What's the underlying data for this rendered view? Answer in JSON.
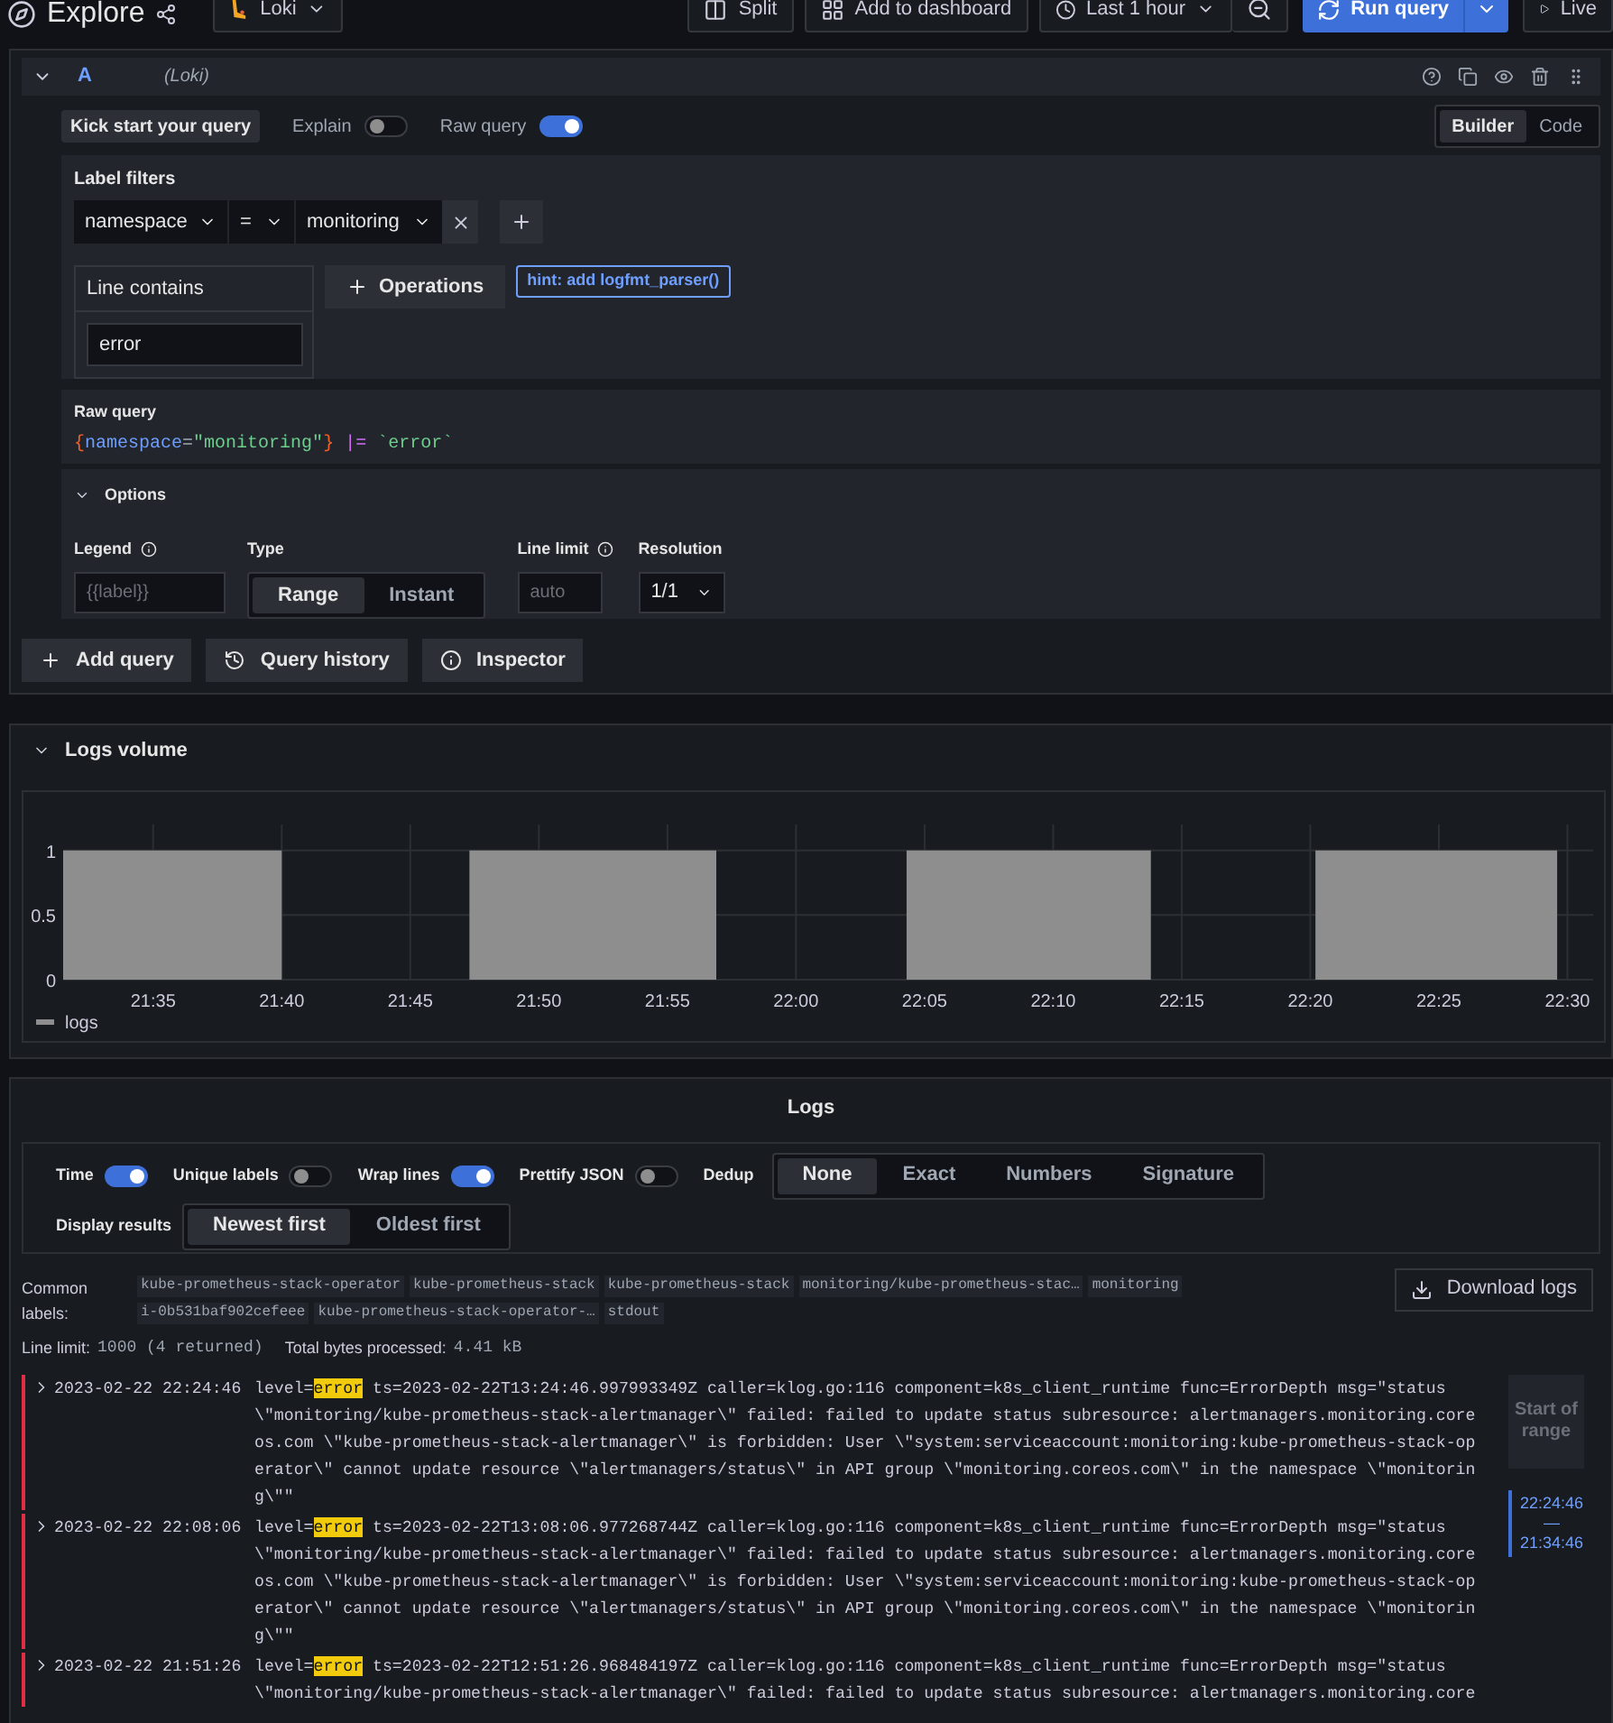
{
  "toolbar": {
    "title": "Explore",
    "datasource": "Loki",
    "split": "Split",
    "add_to_dashboard": "Add to dashboard",
    "time_range": "Last 1 hour",
    "run_query": "Run query",
    "live": "Live"
  },
  "query": {
    "letter": "A",
    "datasource": "(Loki)",
    "kick_start": "Kick start your query",
    "toggles": [
      {
        "label": "Explain",
        "on": false
      },
      {
        "label": "Raw query",
        "on": true
      }
    ],
    "modes": [
      {
        "label": "Builder",
        "selected": true
      },
      {
        "label": "Code",
        "selected": false
      }
    ],
    "label_filters": {
      "title": "Label filters",
      "filters": [
        {
          "label": "namespace",
          "op": "=",
          "value": "monitoring"
        }
      ]
    },
    "line_contains": {
      "title": "Line contains",
      "value": "error"
    },
    "operations": "Operations",
    "hint": "hint: add logfmt_parser()",
    "raw_query": {
      "title": "Raw query",
      "tokens": [
        {
          "kind": "brace",
          "text": "{"
        },
        {
          "kind": "label",
          "text": "namespace"
        },
        {
          "kind": "op",
          "text": "="
        },
        {
          "kind": "string",
          "text": "\"monitoring\""
        },
        {
          "kind": "brace",
          "text": "}"
        },
        {
          "kind": "pipe",
          "text": "|="
        },
        {
          "kind": "string",
          "text": "`error`"
        }
      ]
    },
    "options": {
      "title": "Options",
      "expanded": true,
      "legend": {
        "label": "Legend",
        "placeholder": "{{label}}"
      },
      "type": {
        "label": "Type",
        "options": [
          {
            "label": "Range",
            "selected": true
          },
          {
            "label": "Instant",
            "selected": false
          }
        ]
      },
      "line_limit": {
        "label": "Line limit",
        "placeholder": "auto"
      },
      "resolution": {
        "label": "Resolution",
        "value": "1/1"
      }
    },
    "actions": [
      "Add query",
      "Query history",
      "Inspector"
    ]
  },
  "logs_volume": {
    "title": "Logs volume",
    "expanded": true,
    "chart_data": {
      "type": "area",
      "grid": true,
      "x": [
        1291.5,
        1291.5,
        1300,
        1300,
        1307.3,
        1307.3,
        1316.9,
        1316.9,
        1324.3,
        1324.3,
        1333.8,
        1333.8,
        1340.2,
        1340.2,
        1349.6,
        1349.6
      ],
      "series": [
        {
          "name": "logs",
          "color": "#8e8e8e",
          "values": [
            0,
            1,
            1,
            0,
            0,
            1,
            1,
            0,
            0,
            1,
            1,
            0,
            0,
            1,
            1,
            0
          ]
        }
      ],
      "xlim": [
        1291.5,
        1351
      ],
      "ylim": [
        0,
        1.2
      ],
      "xticks": [
        {
          "value": 1295,
          "label": "21:35"
        },
        {
          "value": 1300,
          "label": "21:40"
        },
        {
          "value": 1305,
          "label": "21:45"
        },
        {
          "value": 1310,
          "label": "21:50"
        },
        {
          "value": 1315,
          "label": "21:55"
        },
        {
          "value": 1320,
          "label": "22:00"
        },
        {
          "value": 1325,
          "label": "22:05"
        },
        {
          "value": 1330,
          "label": "22:10"
        },
        {
          "value": 1335,
          "label": "22:15"
        },
        {
          "value": 1340,
          "label": "22:20"
        },
        {
          "value": 1345,
          "label": "22:25"
        },
        {
          "value": 1350,
          "label": "22:30"
        }
      ],
      "yticks": [
        0,
        0.5,
        1
      ]
    }
  },
  "logs": {
    "title": "Logs",
    "toggles": [
      {
        "label": "Time",
        "on": true
      },
      {
        "label": "Unique labels",
        "on": false
      },
      {
        "label": "Wrap lines",
        "on": true
      },
      {
        "label": "Prettify JSON",
        "on": false
      }
    ],
    "dedup": {
      "label": "Dedup",
      "options": [
        {
          "label": "None",
          "selected": true
        },
        {
          "label": "Exact",
          "selected": false
        },
        {
          "label": "Numbers",
          "selected": false
        },
        {
          "label": "Signature",
          "selected": false
        }
      ]
    },
    "display_results": {
      "label": "Display results",
      "options": [
        {
          "label": "Newest first",
          "selected": true
        },
        {
          "label": "Oldest first",
          "selected": false
        }
      ]
    },
    "common_labels": {
      "label": "Common labels:",
      "values": [
        "kube-prometheus-stack-operator",
        "kube-prometheus-stack",
        "kube-prometheus-stack",
        "monitoring/kube-prometheus-stac…",
        "monitoring",
        "i-0b531baf902cefeee",
        "kube-prometheus-stack-operator-…",
        "stdout"
      ]
    },
    "download": "Download logs",
    "line_limit": {
      "label": "Line limit:",
      "value": "1000 (4 returned)"
    },
    "bytes": {
      "label": "Total bytes processed:",
      "value": "4.41 kB"
    },
    "entries": [
      {
        "time": "2023-02-22 22:24:46",
        "level_key": "level=",
        "level": "error",
        "color": "#e02f44",
        "lines": [
          "ts=2023-02-22T13:24:46.997993349Z caller=klog.go:116 component=k8s_client_runtime func=ErrorDepth msg=\"status",
          "\\\"monitoring/kube-prometheus-stack-alertmanager\\\" failed: failed to update status subresource: alertmanagers.monitoring.core",
          "os.com \\\"kube-prometheus-stack-alertmanager\\\" is forbidden: User \\\"system:serviceaccount:monitoring:kube-prometheus-stack-op",
          "erator\\\" cannot update resource \\\"alertmanagers/status\\\" in API group \\\"monitoring.coreos.com\\\" in the namespace \\\"monitorin",
          "g\\\"\""
        ]
      },
      {
        "time": "2023-02-22 22:08:06",
        "level_key": "level=",
        "level": "error",
        "color": "#e02f44",
        "lines": [
          "ts=2023-02-22T13:08:06.977268744Z caller=klog.go:116 component=k8s_client_runtime func=ErrorDepth msg=\"status",
          "\\\"monitoring/kube-prometheus-stack-alertmanager\\\" failed: failed to update status subresource: alertmanagers.monitoring.core",
          "os.com \\\"kube-prometheus-stack-alertmanager\\\" is forbidden: User \\\"system:serviceaccount:monitoring:kube-prometheus-stack-op",
          "erator\\\" cannot update resource \\\"alertmanagers/status\\\" in API group \\\"monitoring.coreos.com\\\" in the namespace \\\"monitorin",
          "g\\\"\""
        ]
      },
      {
        "time": "2023-02-22 21:51:26",
        "level_key": "level=",
        "level": "error",
        "color": "#e02f44",
        "lines": [
          "ts=2023-02-22T12:51:26.968484197Z caller=klog.go:116 component=k8s_client_runtime func=ErrorDepth msg=\"status",
          "\\\"monitoring/kube-prometheus-stack-alertmanager\\\" failed: failed to update status subresource: alertmanagers.monitoring.core"
        ]
      }
    ],
    "range": {
      "start": "Start of range",
      "from": "22:24:46",
      "dash": "—",
      "to": "21:34:46"
    }
  }
}
